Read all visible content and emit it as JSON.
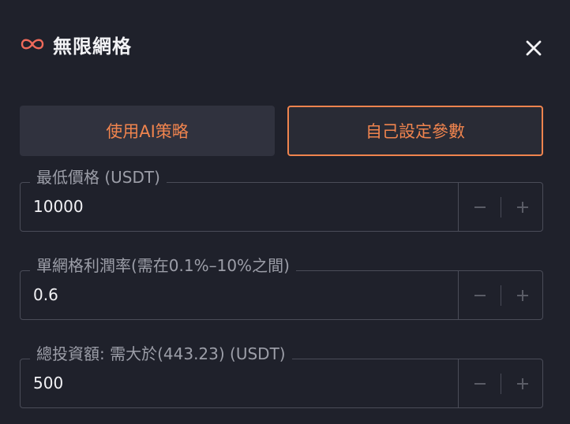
{
  "header": {
    "title": "無限網格",
    "logo_icon": "infinity-icon",
    "close_icon": "close-icon"
  },
  "tabs": [
    {
      "label": "使用AI策略",
      "active": false
    },
    {
      "label": "自己設定參數",
      "active": true
    }
  ],
  "fields": [
    {
      "label": "最低價格 (USDT)",
      "value": "10000"
    },
    {
      "label": "單網格利潤率(需在0.1%–10%之間)",
      "value": "0.6"
    },
    {
      "label": "總投資額: 需大於(443.23) (USDT)",
      "value": "500"
    }
  ],
  "colors": {
    "accent": "#f0844e",
    "background": "#1f212b",
    "tab_bg": "#30323e",
    "border": "#4a4c58"
  }
}
